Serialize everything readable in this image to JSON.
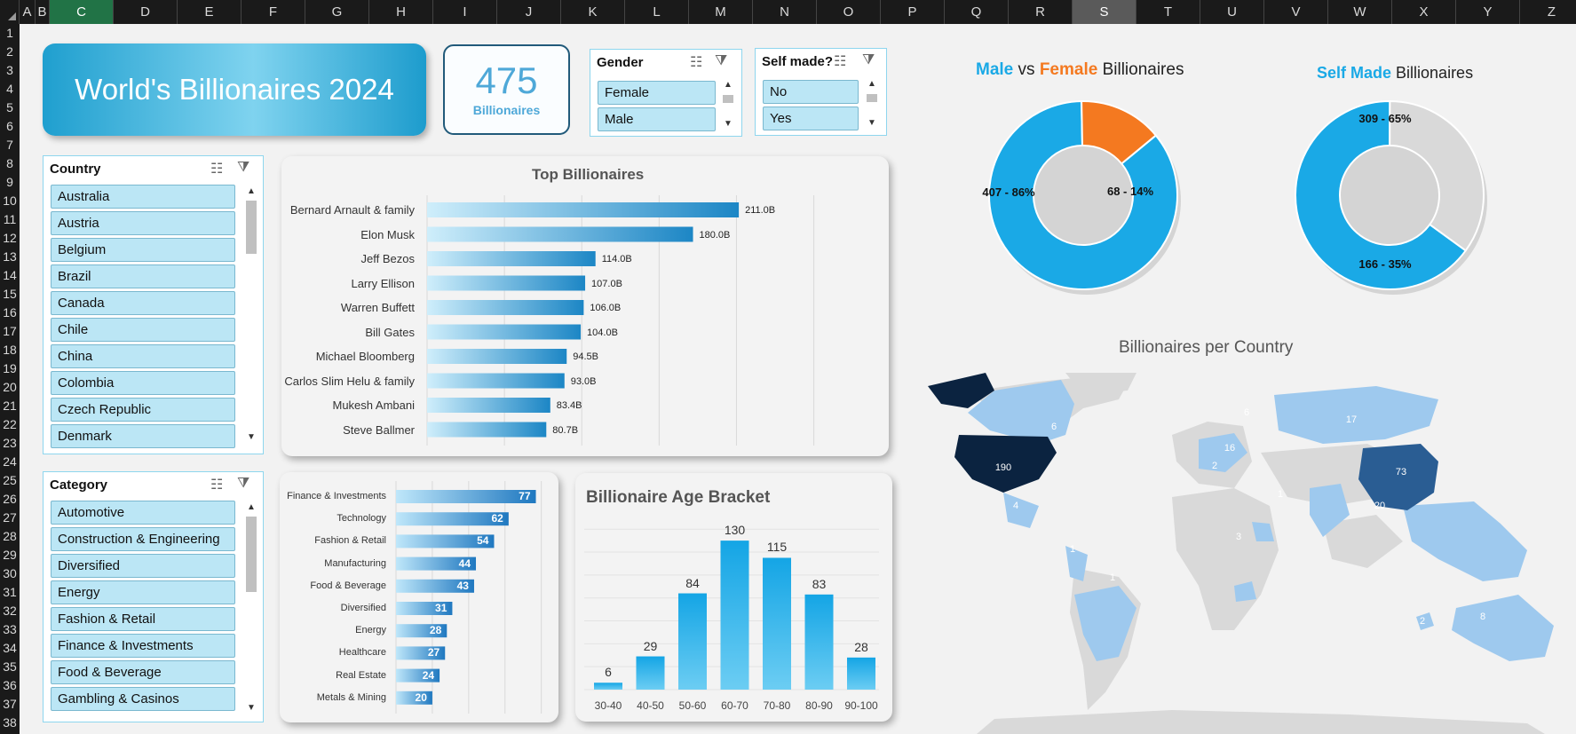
{
  "spreadsheet": {
    "columns": [
      "A",
      "B",
      "C",
      "D",
      "E",
      "F",
      "G",
      "H",
      "I",
      "J",
      "K",
      "L",
      "M",
      "N",
      "O",
      "P",
      "Q",
      "R",
      "S",
      "T",
      "U",
      "V",
      "W",
      "X",
      "Y",
      "Z"
    ],
    "selected_column": "C",
    "highlighted_column": "S",
    "rows": [
      "1",
      "2",
      "3",
      "4",
      "5",
      "6",
      "7",
      "8",
      "9",
      "10",
      "11",
      "12",
      "13",
      "14",
      "15",
      "16",
      "17",
      "18",
      "19",
      "20",
      "21",
      "22",
      "23",
      "24",
      "25",
      "26",
      "27",
      "28",
      "29",
      "30",
      "31",
      "32",
      "33",
      "34",
      "35",
      "36",
      "37",
      "38"
    ]
  },
  "title": "World's Billionaires 2024",
  "kpi": {
    "value": "475",
    "label": "Billionaires"
  },
  "slicers": {
    "gender": {
      "title": "Gender",
      "items": [
        "Female",
        "Male"
      ]
    },
    "self_made": {
      "title": "Self made?",
      "items": [
        "No",
        "Yes"
      ]
    },
    "country": {
      "title": "Country",
      "items": [
        "Australia",
        "Austria",
        "Belgium",
        "Brazil",
        "Canada",
        "Chile",
        "China",
        "Colombia",
        "Czech Republic",
        "Denmark"
      ]
    },
    "category": {
      "title": "Category",
      "items": [
        "Automotive",
        "Construction & Engineering",
        "Diversified",
        "Energy",
        "Fashion & Retail",
        "Finance & Investments",
        "Food & Beverage",
        "Gambling & Casinos"
      ]
    }
  },
  "colors": {
    "accent": "#1aa9e6",
    "dark_blue": "#1f7ab8",
    "orange": "#f47920",
    "grey": "#d9d9d9",
    "navy": "#0b2340"
  },
  "chart_data": [
    {
      "type": "bar",
      "orientation": "horizontal",
      "title": "Top Billionaires",
      "categories": [
        "Bernard Arnault & family",
        "Elon Musk",
        "Jeff Bezos",
        "Larry Ellison",
        "Warren Buffett",
        "Bill Gates",
        "Michael Bloomberg",
        "Carlos Slim Helu & family",
        "Mukesh Ambani",
        "Steve Ballmer"
      ],
      "values": [
        211.0,
        180.0,
        114.0,
        107.0,
        106.0,
        104.0,
        94.5,
        93.0,
        83.4,
        80.7
      ],
      "labels": [
        "211.0B",
        "180.0B",
        "114.0B",
        "107.0B",
        "106.0B",
        "104.0B",
        "94.5B",
        "93.0B",
        "83.4B",
        "80.7B"
      ],
      "xlim": [
        0,
        250
      ],
      "grid": true
    },
    {
      "type": "bar",
      "orientation": "horizontal",
      "title": "",
      "categories": [
        "Finance & Investments",
        "Technology",
        "Fashion & Retail",
        "Manufacturing",
        "Food & Beverage",
        "Diversified",
        "Energy",
        "Healthcare",
        "Real Estate",
        "Metals & Mining"
      ],
      "values": [
        77,
        62,
        54,
        44,
        43,
        31,
        28,
        27,
        24,
        20
      ],
      "xlim": [
        0,
        80
      ],
      "grid": true
    },
    {
      "type": "bar",
      "title": "Billionaire Age Bracket",
      "categories": [
        "30-40",
        "40-50",
        "50-60",
        "60-70",
        "70-80",
        "80-90",
        "90-100"
      ],
      "values": [
        6,
        29,
        84,
        130,
        115,
        83,
        28
      ],
      "ylim": [
        0,
        140
      ],
      "grid": true
    },
    {
      "type": "pie",
      "donut": true,
      "title_parts": [
        "Male",
        " vs ",
        "Female",
        " Billionaires"
      ],
      "slices": [
        {
          "name": "Male",
          "value": 407,
          "label": "407  -  86%",
          "color": "#1aa9e6"
        },
        {
          "name": "Female",
          "value": 68,
          "label": "68  -  14%",
          "color": "#f47920"
        }
      ]
    },
    {
      "type": "pie",
      "donut": true,
      "title_parts": [
        "Self Made",
        " Billionaires"
      ],
      "slices": [
        {
          "name": "Yes",
          "value": 309,
          "label": "309  -  65%",
          "color": "#1aa9e6"
        },
        {
          "name": "No",
          "value": 166,
          "label": "166  -  35%",
          "color": "#d9d9d9"
        }
      ]
    }
  ],
  "map": {
    "title": "Billionaires per Country",
    "labels": [
      "190",
      "73",
      "17",
      "20",
      "6",
      "6",
      "16",
      "2",
      "4",
      "1",
      "3",
      "1",
      "1",
      "8",
      "2"
    ]
  }
}
